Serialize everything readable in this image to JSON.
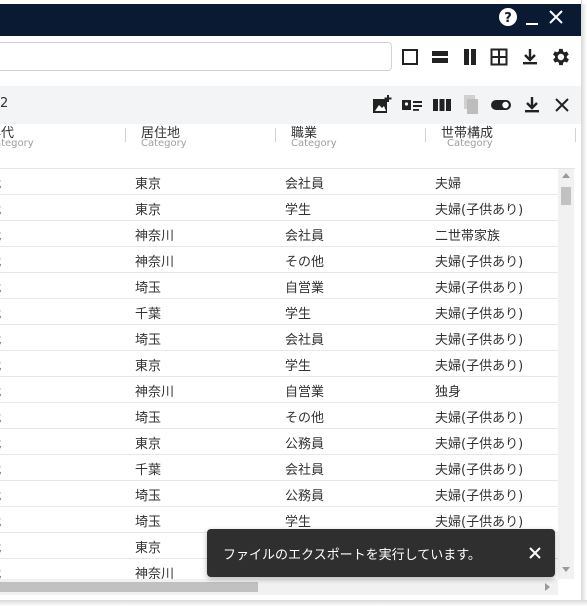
{
  "titlebar": {
    "help_icon": "help-circle-icon",
    "minimize_icon": "minimize-icon",
    "close_icon": "close-icon"
  },
  "toolbar": {
    "search_value": "",
    "icons": [
      "single-view-icon",
      "split-horizontal-icon",
      "split-vertical-icon",
      "grid-view-icon",
      "download-icon",
      "settings-gear-icon"
    ]
  },
  "panel": {
    "count_text": "2",
    "icons": [
      "add-image-icon",
      "card-list-icon",
      "columns-icon",
      "copy-icon",
      "toggle-icon",
      "download-icon",
      "close-icon"
    ],
    "columns": [
      {
        "title": "年代",
        "type": "Category"
      },
      {
        "title": "居住地",
        "type": "Category"
      },
      {
        "title": "職業",
        "type": "Category"
      },
      {
        "title": "世帯構成",
        "type": "Category"
      }
    ],
    "rows": [
      [
        "代",
        "東京",
        "会社員",
        "夫婦"
      ],
      [
        "代",
        "東京",
        "学生",
        "夫婦(子供あり)"
      ],
      [
        "代",
        "神奈川",
        "会社員",
        "二世帯家族"
      ],
      [
        "代",
        "神奈川",
        "その他",
        "夫婦(子供あり)"
      ],
      [
        "代",
        "埼玉",
        "自営業",
        "夫婦(子供あり)"
      ],
      [
        "代",
        "千葉",
        "学生",
        "夫婦(子供あり)"
      ],
      [
        "代",
        "埼玉",
        "会社員",
        "夫婦(子供あり)"
      ],
      [
        "代",
        "東京",
        "学生",
        "夫婦(子供あり)"
      ],
      [
        "代",
        "神奈川",
        "自営業",
        "独身"
      ],
      [
        "代",
        "埼玉",
        "その他",
        "夫婦(子供あり)"
      ],
      [
        "代",
        "東京",
        "公務員",
        "夫婦(子供あり)"
      ],
      [
        "代",
        "千葉",
        "会社員",
        "夫婦(子供あり)"
      ],
      [
        "代",
        "埼玉",
        "公務員",
        "夫婦(子供あり)"
      ],
      [
        "代",
        "埼玉",
        "学生",
        "夫婦(子供あり)"
      ],
      [
        "代",
        "東京",
        "",
        ""
      ],
      [
        "代",
        "神奈川",
        "",
        ""
      ]
    ]
  },
  "toast": {
    "message": "ファイルのエクスポートを実行しています。",
    "close_icon": "close-icon"
  },
  "colors": {
    "titlebar": "#0b1a33",
    "toast_bg": "#2f2f2f",
    "header_bg": "#f3f4f6"
  }
}
